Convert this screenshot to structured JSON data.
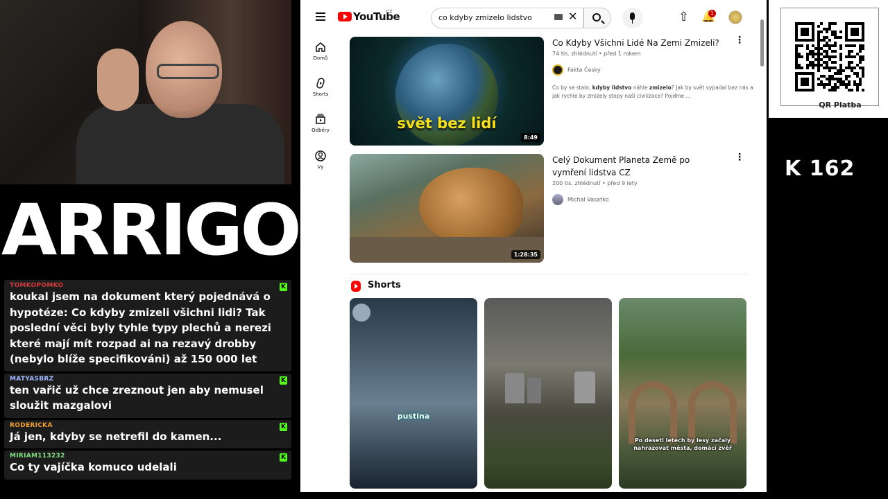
{
  "stream": {
    "logo_text": "ARRIGOS",
    "qr_label": "QR Platba",
    "k_counter": "K 162"
  },
  "chat": [
    {
      "user": "TOMKOPOMKO",
      "user_color": "#d43a3a",
      "text": "koukal jsem na dokument který pojednává o hypotéze: Co kdyby zmizeli všichni lidi? Tak poslední věci byly tyhle typy plechů a nerezi které mají mít rozpad ai na rezavý drobby (nebylo blíže specifikováni) až 150 000 let",
      "badge": "K"
    },
    {
      "user": "MATYASBRZ",
      "user_color": "#9fb8ff",
      "text": "ten vařič už chce zreznout jen aby nemusel sloužit mazgalovi",
      "badge": "K"
    },
    {
      "user": "RODERICKA",
      "user_color": "#f0a030",
      "text": "Já jen, kdyby se netrefil do kamen...",
      "badge": "K"
    },
    {
      "user": "MIRIAM113232",
      "user_color": "#7fe07f",
      "text": "Co ty vajíčka komuco udelali",
      "badge": "K"
    }
  ],
  "youtube": {
    "brand": "YouTube",
    "region": "CZ",
    "search_value": "co kdyby zmizelo lidstvo",
    "notification_count": "1",
    "sidebar": [
      {
        "label": "Domů",
        "icon": "home-icon"
      },
      {
        "label": "Shorts",
        "icon": "shorts-icon"
      },
      {
        "label": "Odběry",
        "icon": "subscriptions-icon"
      },
      {
        "label": "Vy",
        "icon": "profile-icon"
      }
    ],
    "videos": [
      {
        "title": "Co Kdyby Všichni Lidé Na Zemi Zmizeli?",
        "views": "74 tis. zhlédnutí",
        "age": "před 1 rokem",
        "channel": "Fakta Česky",
        "description_parts": [
          "Co by se stalo, ",
          "kdyby lidstvo",
          " náhle ",
          "zmizelo",
          "? Jak by svět vypadal bez nás a jak rychle by zmizely stopy naší civilizace? Pojďme ..."
        ],
        "duration": "8:49",
        "thumb_caption": "svět bez lidí"
      },
      {
        "title": "Celý Dokument Planeta Země po vymření lidstva CZ",
        "views": "200 tis. zhlédnutí",
        "age": "před 9 lety",
        "channel": "Michal Vasatko",
        "duration": "1:28:35"
      }
    ],
    "shorts_label": "Shorts",
    "shorts": [
      {
        "caption": "pustina"
      },
      {
        "caption": ""
      },
      {
        "caption": "Po deseti letech by lesy začaly nahrazovat města, domácí zvěř"
      }
    ]
  }
}
